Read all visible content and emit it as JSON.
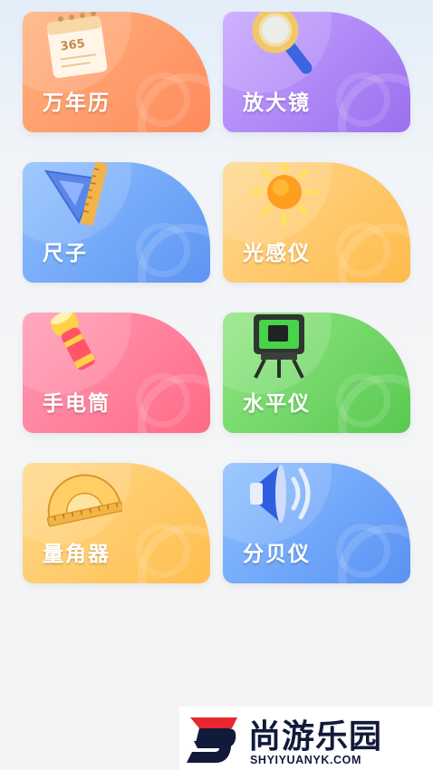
{
  "tools": [
    {
      "label": "万年历",
      "icon": "calendar-icon",
      "color": "#ff8f5f",
      "calendar_number": "365"
    },
    {
      "label": "放大镜",
      "icon": "magnifier-icon",
      "color": "#a27af1"
    },
    {
      "label": "尺子",
      "icon": "ruler-icon",
      "color": "#6298f3"
    },
    {
      "label": "光感仪",
      "icon": "sun-icon",
      "color": "#ffbd50"
    },
    {
      "label": "手电筒",
      "icon": "flashlight-icon",
      "color": "#ff6e89"
    },
    {
      "label": "水平仪",
      "icon": "laser-level-icon",
      "color": "#5dca53"
    },
    {
      "label": "量角器",
      "icon": "protractor-icon",
      "color": "#ffc055"
    },
    {
      "label": "分贝仪",
      "icon": "speaker-icon",
      "color": "#5d94f4"
    }
  ],
  "watermark": {
    "title": "尚游乐园",
    "subtitle": "SHYIYUANYK.COM",
    "brand_color": "#121a3a",
    "accent_color": "#e8262f"
  }
}
